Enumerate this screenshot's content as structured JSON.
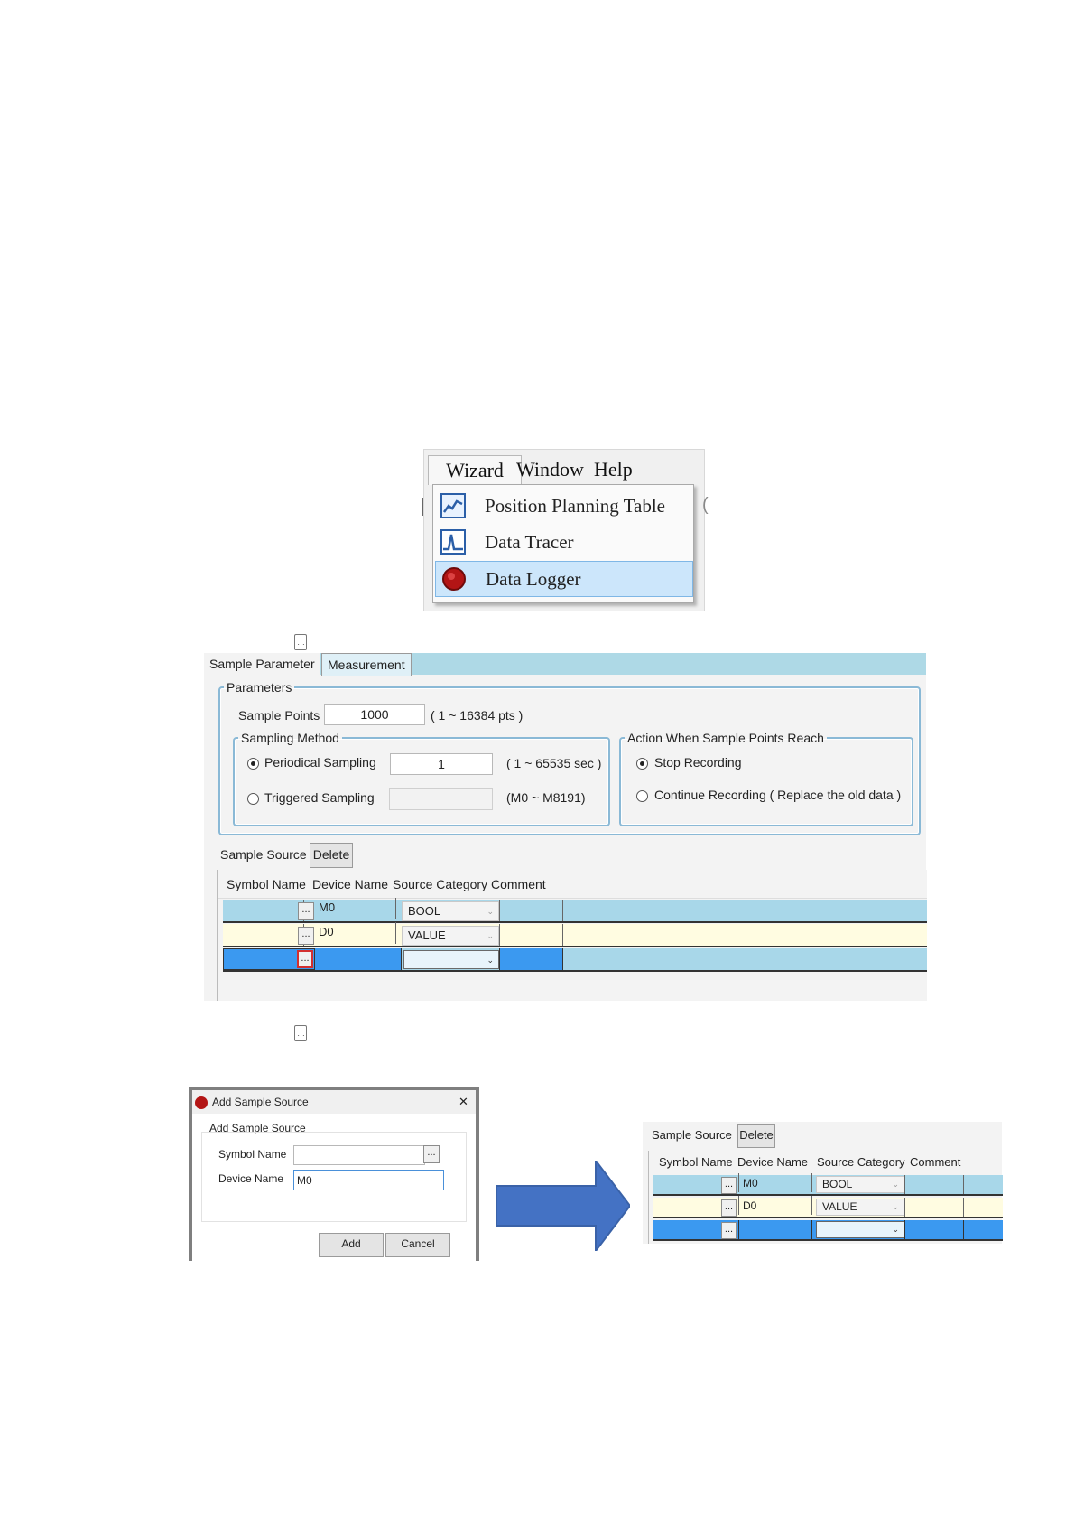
{
  "menu": {
    "bar": [
      "Wizard",
      "Window",
      "Help"
    ],
    "items": [
      {
        "label": "Position Planning Table",
        "icon": "line-chart-icon",
        "highlighted": false
      },
      {
        "label": "Data Tracer",
        "icon": "waveform-icon",
        "highlighted": false
      },
      {
        "label": "Data Logger",
        "icon": "red-record-icon",
        "highlighted": true
      }
    ]
  },
  "logger": {
    "tabs": [
      "Sample Parameter",
      "Measurement"
    ],
    "parameters_legend": "Parameters",
    "sample_points_label": "Sample Points",
    "sample_points_value": "1000",
    "sample_points_range": "( 1 ~ 16384 pts )",
    "sampling_method_legend": "Sampling Method",
    "periodical_label": "Periodical Sampling",
    "periodical_value": "1",
    "periodical_range": "( 1 ~ 65535 sec )",
    "triggered_label": "Triggered Sampling",
    "triggered_value": "",
    "triggered_range": "(M0 ~ M8191)",
    "action_legend": "Action When Sample Points Reach",
    "stop_label": "Stop Recording",
    "continue_label": "Continue Recording ( Replace the old data )",
    "sample_source_label": "Sample Source",
    "delete_label": "Delete",
    "columns": [
      "Symbol Name",
      "Device Name",
      "Source Category",
      "Comment"
    ],
    "rows": [
      {
        "symbol": "",
        "device": "M0",
        "category": "BOOL",
        "comment": ""
      },
      {
        "symbol": "",
        "device": "D0",
        "category": "VALUE",
        "comment": ""
      },
      {
        "symbol": "",
        "device": "",
        "category": "",
        "comment": ""
      }
    ],
    "ellipsis": "..."
  },
  "dialog": {
    "title": "Add Sample Source",
    "close": "✕",
    "group": "Add Sample Source",
    "symbol_label": "Symbol Name",
    "symbol_value": "",
    "device_label": "Device Name",
    "device_value": "M0",
    "add": "Add",
    "cancel": "Cancel",
    "ellipsis": "..."
  },
  "result": {
    "sample_source_label": "Sample Source",
    "delete_label": "Delete",
    "columns": [
      "Symbol Name",
      "Device Name",
      "Source Category",
      "Comment"
    ],
    "rows": [
      {
        "device": "M0",
        "category": "BOOL"
      },
      {
        "device": "D0",
        "category": "VALUE"
      },
      {
        "device": "",
        "category": ""
      }
    ],
    "ellipsis": "..."
  },
  "colors": {
    "row_blue": "#a8d7e9",
    "row_yellow": "#fffce1",
    "row_selected": "#3b99f0",
    "tabbar": "#aed9e6",
    "arrow": "#4472c4"
  }
}
